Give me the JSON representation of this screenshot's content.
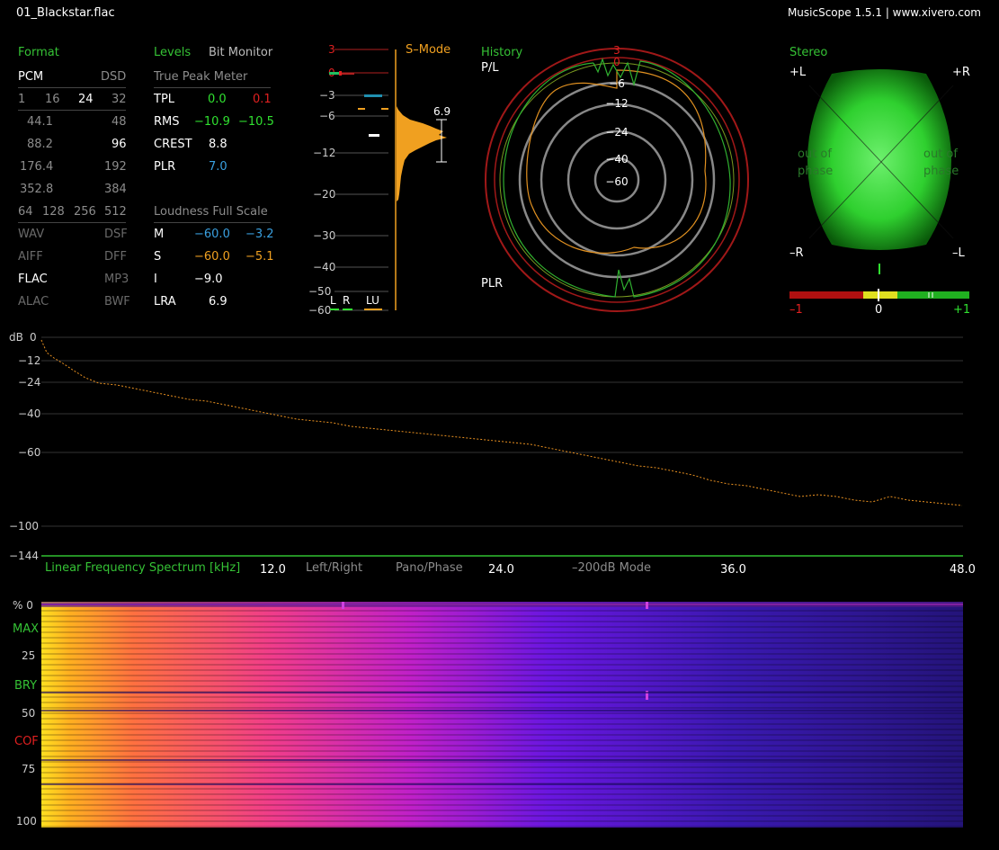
{
  "header": {
    "filename": "01_Blackstar.flac",
    "app_title": "MusicScope 1.5.1 | www.xivero.com"
  },
  "format": {
    "title": "Format",
    "pcm": "PCM",
    "dsd": "DSD",
    "bits": [
      "1",
      "16",
      "24",
      "32"
    ],
    "rates": [
      [
        "44.1",
        "48"
      ],
      [
        "88.2",
        "96"
      ],
      [
        "176.4",
        "192"
      ],
      [
        "352.8",
        "384"
      ]
    ],
    "dsd_rates": [
      "64",
      "128",
      "256",
      "512"
    ],
    "containers": [
      [
        "WAV",
        "DSF"
      ],
      [
        "AIFF",
        "DFF"
      ],
      [
        "FLAC",
        "MP3"
      ],
      [
        "ALAC",
        "BWF"
      ]
    ]
  },
  "levels": {
    "title": "Levels",
    "bit_monitor": "Bit Monitor",
    "true_peak_title": "True Peak Meter",
    "rows": [
      {
        "label": "TPL",
        "v1": "0.0",
        "v2": "0.1"
      },
      {
        "label": "RMS",
        "v1": "−10.9",
        "v2": "−10.5"
      },
      {
        "label": "CREST",
        "v1": "8.8",
        "v2": ""
      },
      {
        "label": "PLR",
        "v1": "7.0",
        "v2": ""
      }
    ],
    "loudness_title": "Loudness Full Scale",
    "loud_rows": [
      {
        "label": "M",
        "v1": "−60.0",
        "v2": "−3.2"
      },
      {
        "label": "S",
        "v1": "−60.0",
        "v2": "−5.1"
      },
      {
        "label": "I",
        "v1": "−9.0",
        "v2": ""
      },
      {
        "label": "LRA",
        "v1": "6.9",
        "v2": ""
      }
    ]
  },
  "meter": {
    "mode": "S–Mode",
    "scale": [
      "3",
      "0",
      "−3",
      "−6",
      "−12",
      "−20",
      "−30",
      "−40",
      "−50",
      "−60"
    ],
    "lra_value": "6.9",
    "legend": [
      "L",
      "R",
      "LU"
    ]
  },
  "history": {
    "title": "History",
    "pl": "P/L",
    "plr": "PLR",
    "rings": [
      "3",
      "0",
      "−6",
      "−12",
      "−24",
      "−40",
      "−60"
    ]
  },
  "stereo": {
    "title": "Stereo",
    "corners": [
      "+L",
      "+R",
      "–R",
      "–L"
    ],
    "out_of_phase": "out of phase",
    "corr_labels": [
      "–1",
      "0",
      "+1"
    ]
  },
  "spectrum": {
    "db_label": "dB",
    "y_ticks": [
      "0",
      "−12",
      "−24",
      "−40",
      "−60",
      "−100",
      "−144"
    ],
    "title": "Linear Frequency Spectrum [kHz]",
    "x_ticks": [
      "12.0",
      "24.0",
      "36.0",
      "48.0"
    ],
    "modes": [
      "Left/Right",
      "Pano/Phase",
      "–200dB Mode"
    ]
  },
  "spectrogram": {
    "y_ticks": [
      "%  0",
      "25",
      "50",
      "75",
      "100"
    ],
    "side_labels": [
      "MAX",
      "BRY",
      "COF"
    ]
  },
  "colors": {
    "accent_green": "#35c235",
    "orange": "#f0a020",
    "red": "#e02020",
    "blue": "#3aa0e0"
  }
}
